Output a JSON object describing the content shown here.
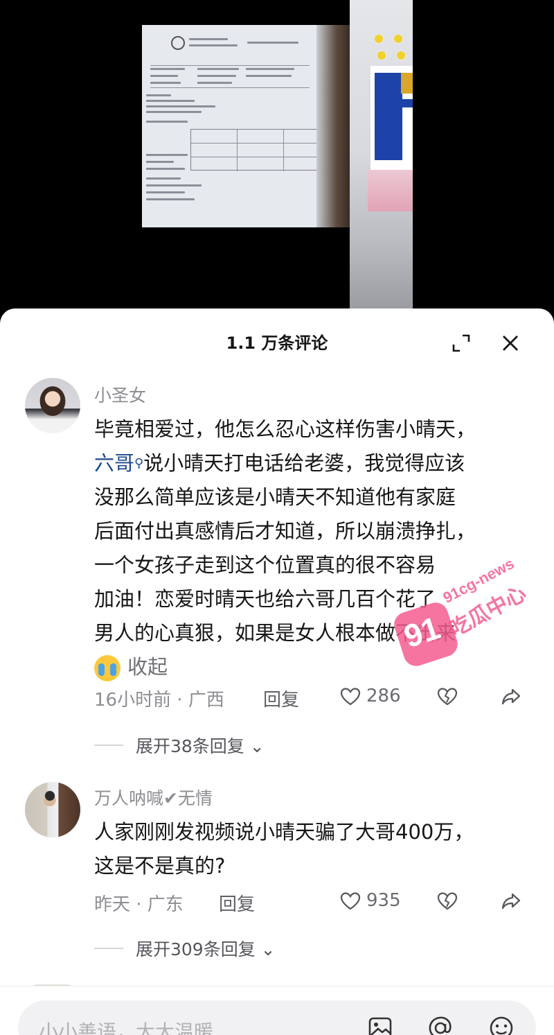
{
  "sheet": {
    "title": "1.1 万条评论",
    "expand_icon": "expand-icon",
    "close_icon": "close-icon"
  },
  "comments": [
    {
      "username": "小圣女",
      "lines": [
        "毕竟相爱过，他怎么忍心这样伤害小晴天，",
        "说小晴天打电话给老婆，我觉得应该",
        "没那么简单应该是小晴天不知道他有家庭",
        "后面付出真感情后才知道，所以崩溃挣扎，",
        "一个女孩子走到这个位置真的很不容易",
        "加油！恋爱时晴天也给六哥几百个花了",
        "男人的心真狠，如果是女人根本做不出来"
      ],
      "hashtag": "六哥",
      "collapse_label": "收起",
      "time": "16小时前 · 广西",
      "reply_label": "回复",
      "likes": "286",
      "expand_replies": "展开38条回复"
    },
    {
      "username": "万人呐喊✔无情",
      "lines": [
        "人家刚刚发视频说小晴天骗了大哥400万，",
        "这是不是真的?"
      ],
      "time": "昨天 · 广东",
      "reply_label": "回复",
      "likes": "935",
      "expand_replies": "展开309条回复"
    }
  ],
  "input": {
    "placeholder": "小小善语，大大温暖",
    "icons": [
      "image-icon",
      "mention-icon",
      "emoji-icon"
    ]
  },
  "watermark": {
    "badge": "91",
    "url": "91cg-news",
    "name": "吃瓜中心"
  }
}
